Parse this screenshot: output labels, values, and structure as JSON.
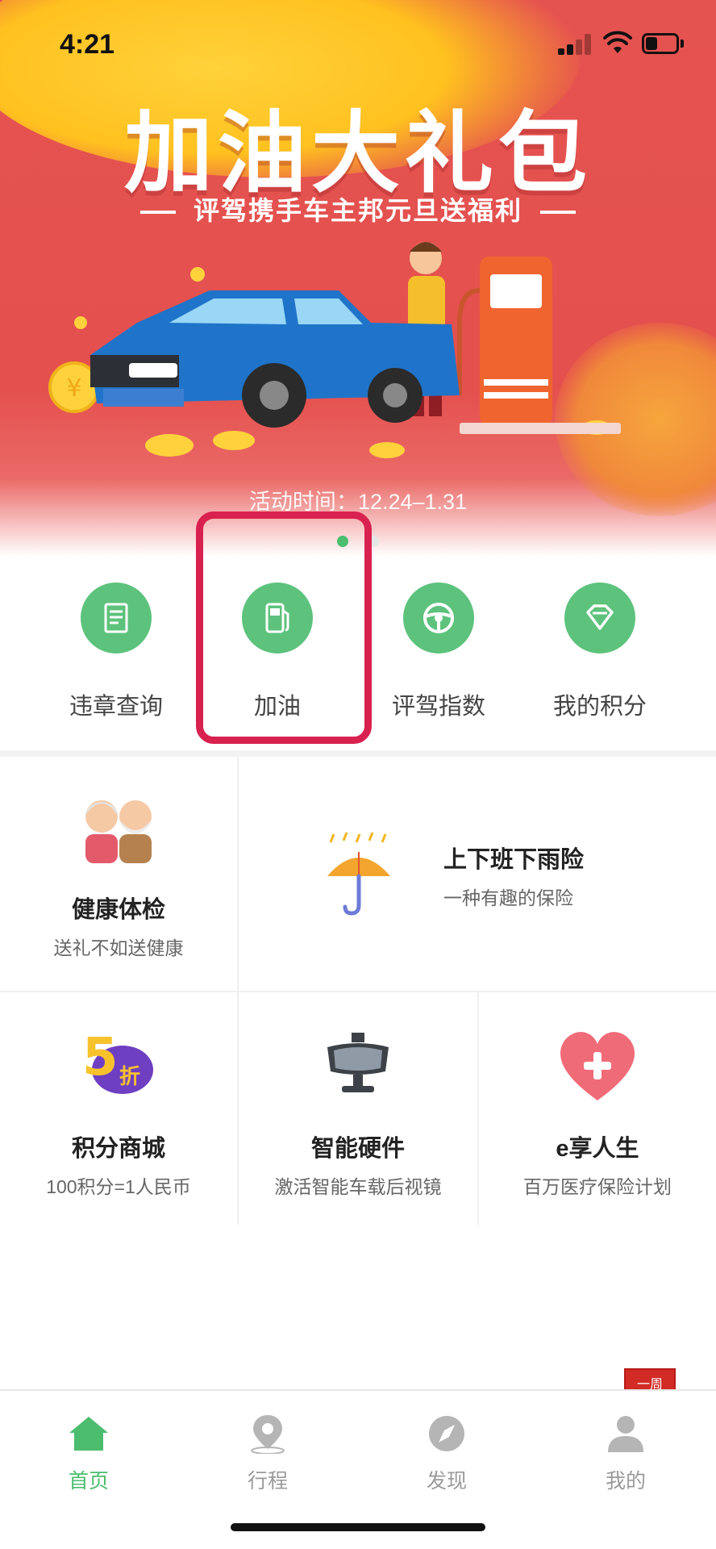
{
  "status_bar": {
    "time": "4:21"
  },
  "banner": {
    "title": "加油大礼包",
    "subtitle": "评驾携手车主邦元旦送福利",
    "activity_time": "活动时间：12.24–1.31",
    "pager": {
      "count": 2,
      "active_index": 0
    },
    "colors": {
      "background": "#e4504e",
      "accent": "#ffd23a"
    }
  },
  "quick_menu": {
    "items": [
      {
        "label": "违章查询",
        "icon": "receipt-icon"
      },
      {
        "label": "加油",
        "icon": "fuel-pump-icon",
        "highlighted": true
      },
      {
        "label": "评驾指数",
        "icon": "steering-wheel-icon"
      },
      {
        "label": "我的积分",
        "icon": "diamond-icon"
      }
    ],
    "icon_color": "#5dc27c",
    "highlight_color": "#d9214f"
  },
  "cards": {
    "health": {
      "title": "健康体检",
      "subtitle": "送礼不如送健康",
      "icon": "elderly-couple-icon"
    },
    "rain": {
      "title": "上下班下雨险",
      "subtitle": "一种有趣的保险",
      "icon": "umbrella-rain-icon"
    },
    "mall": {
      "title": "积分商城",
      "subtitle": "100积分=1人民币",
      "icon": "discount-badge-icon",
      "badge_number": "5",
      "badge_text": "折"
    },
    "hardware": {
      "title": "智能硬件",
      "subtitle": "激活智能车载后视镜",
      "icon": "rearview-mirror-icon"
    },
    "life": {
      "title": "e享人生",
      "subtitle": "百万医疗保险计划",
      "icon": "heart-plus-icon"
    }
  },
  "tabbar": {
    "items": [
      {
        "label": "首页",
        "icon": "home-icon",
        "active": true
      },
      {
        "label": "行程",
        "icon": "location-pin-icon",
        "active": false
      },
      {
        "label": "发现",
        "icon": "compass-icon",
        "active": false
      },
      {
        "label": "我的",
        "icon": "user-icon",
        "active": false
      }
    ],
    "active_color": "#4cbc6e",
    "inactive_color": "#9a9a9a"
  },
  "watermark": {
    "text": "一周一景",
    "color": "#d22a24"
  }
}
